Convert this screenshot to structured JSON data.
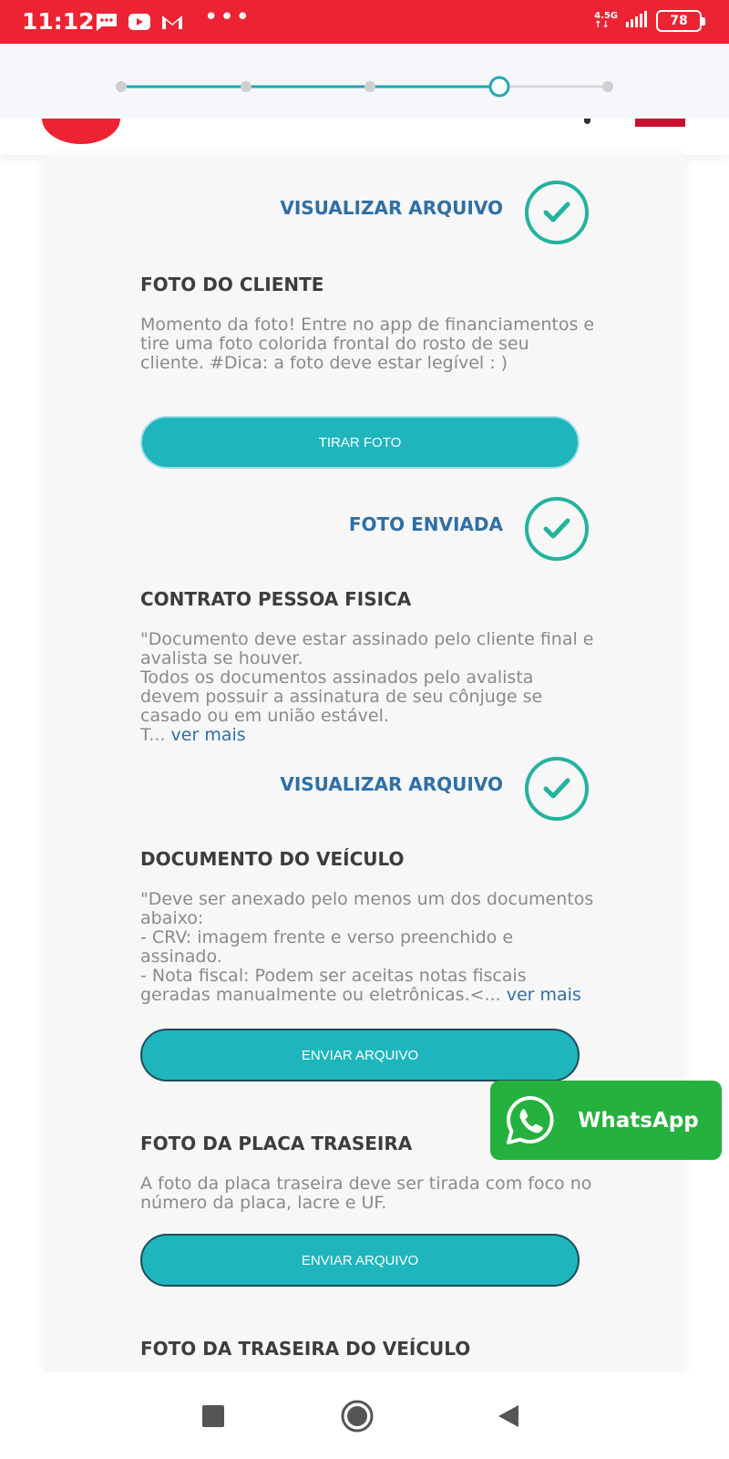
{
  "status_bar": {
    "time": "11:12",
    "network": "4.5G",
    "battery": "78",
    "more": "•••"
  },
  "colors": {
    "accent": "#1fb5bd",
    "status_bar": "#ec2333",
    "link": "#2f6fa5",
    "check": "#23b39f",
    "whatsapp": "#25b13e"
  },
  "stepper": {
    "steps": 5,
    "current_step": 4
  },
  "content": {
    "status1": {
      "label": "VISUALIZAR ARQUIVO"
    },
    "foto_cliente": {
      "title": "FOTO DO CLIENTE",
      "description": "Momento da foto! Entre no app de financiamentos e tire uma foto colorida frontal do rosto de seu cliente. #Dica: a foto deve estar legível : )",
      "button": "TIRAR FOTO",
      "status": "FOTO ENVIADA"
    },
    "contrato": {
      "title": "CONTRATO PESSOA FISICA",
      "line1": "\"Documento deve estar assinado pelo cliente final e avalista se houver.",
      "line2": "Todos os documentos assinados pelo avalista devem possuir a assinatura de seu cônjuge se casado ou em união estável.",
      "line3": "T...",
      "ver_mais": "ver mais",
      "status": "VISUALIZAR ARQUIVO"
    },
    "documento_veiculo": {
      "title": "DOCUMENTO DO VEÍCULO",
      "line1": "\"Deve ser anexado pelo menos um dos documentos abaixo:",
      "line2": "- CRV: imagem frente e verso preenchido e assinado.",
      "line3": "- Nota fiscal: Podem ser aceitas notas fiscais geradas manualmente ou eletrônicas.<...",
      "ver_mais": "ver mais",
      "button": "ENVIAR ARQUIVO"
    },
    "placa_traseira": {
      "title": "FOTO DA PLACA TRASEIRA",
      "description": "A foto da placa traseira deve ser tirada com foco no número da placa, lacre e UF.",
      "button": "ENVIAR ARQUIVO"
    },
    "traseira_veiculo": {
      "title": "FOTO DA TRASEIRA DO VEÍCULO"
    }
  },
  "whatsapp": {
    "label": "WhatsApp"
  },
  "icons": {
    "messages": "message-icon",
    "youtube": "youtube-icon",
    "gmail": "gmail-icon",
    "check": "check-icon",
    "whatsapp": "whatsapp-icon",
    "recents": "square-nav-icon",
    "home": "circle-nav-icon",
    "back": "triangle-back-icon"
  }
}
